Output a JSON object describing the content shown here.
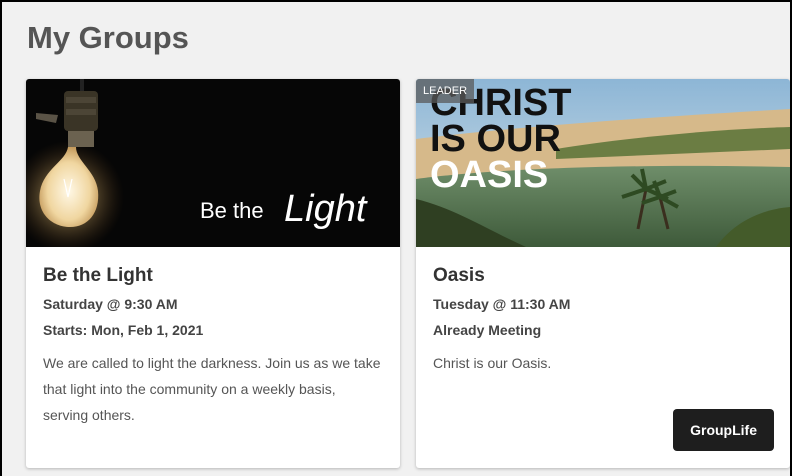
{
  "page": {
    "title": "My Groups"
  },
  "groups": [
    {
      "image_text_prefix": "Be the",
      "image_text_script": "Light",
      "title": "Be the Light",
      "schedule": "Saturday @ 9:30 AM",
      "status": "Starts: Mon, Feb 1, 2021",
      "description": "We are called to light the darkness. Join us as we take that light into the community on a weekly basis, serving others."
    },
    {
      "badge": "LEADER",
      "image_text_lines": [
        "CHRIST",
        "IS OUR",
        "OASIS"
      ],
      "title": "Oasis",
      "schedule": "Tuesday @ 11:30 AM",
      "status": "Already Meeting",
      "description": "Christ is our Oasis.",
      "action_label": "GroupLife"
    }
  ]
}
